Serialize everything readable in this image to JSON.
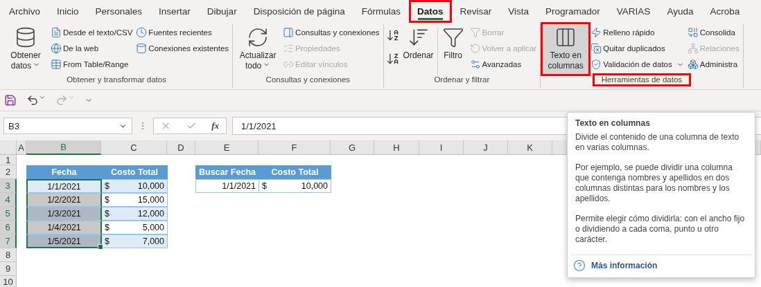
{
  "ribbon_tabs": [
    {
      "label": "Archivo",
      "selected": false,
      "outlined": false
    },
    {
      "label": "Inicio",
      "selected": false,
      "outlined": false
    },
    {
      "label": "Personales",
      "selected": false,
      "outlined": false
    },
    {
      "label": "Insertar",
      "selected": false,
      "outlined": false
    },
    {
      "label": "Dibujar",
      "selected": false,
      "outlined": false
    },
    {
      "label": "Disposición de página",
      "selected": false,
      "outlined": false
    },
    {
      "label": "Fórmulas",
      "selected": false,
      "outlined": false
    },
    {
      "label": "Datos",
      "selected": true,
      "outlined": true
    },
    {
      "label": "Revisar",
      "selected": false,
      "outlined": false
    },
    {
      "label": "Vista",
      "selected": false,
      "outlined": false
    },
    {
      "label": "Programador",
      "selected": false,
      "outlined": false
    },
    {
      "label": "VARIAS",
      "selected": false,
      "outlined": false
    },
    {
      "label": "Ayuda",
      "selected": false,
      "outlined": false
    },
    {
      "label": "Acroba",
      "selected": false,
      "outlined": false
    }
  ],
  "ribbon_groups": [
    {
      "label": "Obtener y transformar datos",
      "outlined": false,
      "columns": [
        {
          "kind": "large",
          "label": "Obtener datos",
          "dropdown": true,
          "hovered": false,
          "outlined": false
        },
        {
          "kind": "stack",
          "items": [
            {
              "label": "Desde el texto/CSV",
              "disabled": false,
              "dropdown": false
            },
            {
              "label": "De la web",
              "disabled": false,
              "dropdown": false
            },
            {
              "label": "From Table/Range",
              "disabled": false,
              "dropdown": false
            }
          ]
        },
        {
          "kind": "stack",
          "items": [
            {
              "label": "Fuentes recientes",
              "disabled": false,
              "dropdown": false
            },
            {
              "label": "Conexiones existentes",
              "disabled": false,
              "dropdown": false
            }
          ]
        }
      ]
    },
    {
      "label": "Consultas y conexiones",
      "outlined": false,
      "columns": [
        {
          "kind": "large",
          "label": "Actualizar todo",
          "dropdown": true,
          "hovered": false,
          "outlined": false
        },
        {
          "kind": "stack",
          "items": [
            {
              "label": "Consultas y conexiones",
              "disabled": false,
              "dropdown": false
            },
            {
              "label": "Propiedades",
              "disabled": true,
              "dropdown": false
            },
            {
              "label": "Editar vínculos",
              "disabled": true,
              "dropdown": false
            }
          ]
        }
      ]
    },
    {
      "label": "Ordenar y filtrar",
      "outlined": false,
      "columns": [
        {
          "kind": "sort"
        },
        {
          "kind": "large",
          "label": "Ordenar",
          "dropdown": false,
          "hovered": false,
          "outlined": false
        },
        {
          "kind": "separator"
        },
        {
          "kind": "large",
          "label": "Filtro",
          "dropdown": false,
          "hovered": false,
          "outlined": false
        },
        {
          "kind": "stack",
          "items": [
            {
              "label": "Borrar",
              "disabled": true,
              "dropdown": false
            },
            {
              "label": "Volver a aplicar",
              "disabled": true,
              "dropdown": false
            },
            {
              "label": "Avanzadas",
              "disabled": false,
              "dropdown": false
            }
          ]
        }
      ]
    },
    {
      "label": "Herramientas de datos",
      "outlined": true,
      "columns": [
        {
          "kind": "large",
          "label": "Texto en columnas",
          "dropdown": false,
          "hovered": true,
          "outlined": true
        },
        {
          "kind": "stack",
          "items": [
            {
              "label": "Relleno rápido",
              "disabled": false,
              "dropdown": false
            },
            {
              "label": "Quitar duplicados",
              "disabled": false,
              "dropdown": false
            },
            {
              "label": "Validación de datos",
              "disabled": false,
              "dropdown": true
            }
          ]
        },
        {
          "kind": "stack",
          "items": [
            {
              "label": "Consolida",
              "disabled": false,
              "dropdown": false
            },
            {
              "label": "Relaciones",
              "disabled": true,
              "dropdown": false
            },
            {
              "label": "Administra",
              "disabled": false,
              "dropdown": false
            }
          ]
        }
      ]
    }
  ],
  "quick_access": [
    {
      "kind": "save",
      "disabled": false
    },
    {
      "kind": "undo",
      "disabled": false
    },
    {
      "kind": "redo",
      "disabled": true
    },
    {
      "kind": "customize",
      "disabled": false
    }
  ],
  "formula_bar": {
    "name_box": "B3",
    "function_label": "fx",
    "value": "1/1/2021"
  },
  "sheet": {
    "columns": [
      {
        "label": "A",
        "selected": false
      },
      {
        "label": "B",
        "selected": true
      },
      {
        "label": "C",
        "selected": false
      },
      {
        "label": "D",
        "selected": false
      },
      {
        "label": "E",
        "selected": false
      },
      {
        "label": "F",
        "selected": false
      },
      {
        "label": "G",
        "selected": false
      },
      {
        "label": "H",
        "selected": false
      },
      {
        "label": "I",
        "selected": false
      },
      {
        "label": "J",
        "selected": false
      },
      {
        "label": "K",
        "selected": false
      }
    ],
    "rows": [
      {
        "label": "1",
        "selected": false
      },
      {
        "label": "2",
        "selected": false,
        "cells": {
          "b": {
            "kind": "header",
            "text": "Fecha"
          },
          "c": {
            "kind": "header",
            "text": "Costo Total"
          },
          "e": {
            "kind": "header",
            "text": "Buscar Fecha"
          },
          "f": {
            "kind": "header",
            "text": "Costo Total"
          }
        }
      },
      {
        "label": "3",
        "selected": true,
        "cells": {
          "b": {
            "kind": "label",
            "text": "1/1/2021",
            "banded": true,
            "selected": true,
            "active": true
          },
          "c": {
            "kind": "currency",
            "symbol": "$",
            "text": "10,000",
            "banded": true,
            "selected": false,
            "active": false
          },
          "e": {
            "kind": "number",
            "text": "1/1/2021",
            "banded": false,
            "selected": false,
            "active": false
          },
          "f": {
            "kind": "currency",
            "symbol": "$",
            "text": "10,000",
            "banded": false,
            "selected": false,
            "active": false
          }
        }
      },
      {
        "label": "4",
        "selected": true,
        "cells": {
          "b": {
            "kind": "label",
            "text": "1/2/2021",
            "banded": false,
            "selected": true,
            "active": false
          },
          "c": {
            "kind": "currency",
            "symbol": "$",
            "text": "15,000",
            "banded": false,
            "selected": false,
            "active": false
          }
        }
      },
      {
        "label": "5",
        "selected": true,
        "cells": {
          "b": {
            "kind": "label",
            "text": "1/3/2021",
            "banded": true,
            "selected": true,
            "active": false
          },
          "c": {
            "kind": "currency",
            "symbol": "$",
            "text": "12,000",
            "banded": true,
            "selected": false,
            "active": false
          }
        }
      },
      {
        "label": "6",
        "selected": true,
        "cells": {
          "b": {
            "kind": "label",
            "text": "1/4/2021",
            "banded": false,
            "selected": true,
            "active": false
          },
          "c": {
            "kind": "currency",
            "symbol": "$",
            "text": "5,000",
            "banded": false,
            "selected": false,
            "active": false
          }
        }
      },
      {
        "label": "7",
        "selected": true,
        "cells": {
          "b": {
            "kind": "label",
            "text": "1/5/2021",
            "banded": true,
            "selected": true,
            "active": false
          },
          "c": {
            "kind": "currency",
            "symbol": "$",
            "text": "7,000",
            "banded": true,
            "selected": false,
            "active": false
          }
        }
      },
      {
        "label": "8",
        "selected": false
      },
      {
        "label": "9",
        "selected": false
      },
      {
        "label": "10",
        "selected": false
      }
    ]
  },
  "tooltip": {
    "title": "Texto en columnas",
    "paragraphs": [
      "Divide el contenido de una columna de texto en varias columnas.",
      "Por ejemplo, se puede dividir una columna que contenga nombres y apellidos en dos columnas distintas para los nombres y los apellidos.",
      "Permite elegir cómo dividirla: con el ancho fijo o dividiendo a cada coma, punto u otro carácter."
    ],
    "link": "Más información"
  }
}
